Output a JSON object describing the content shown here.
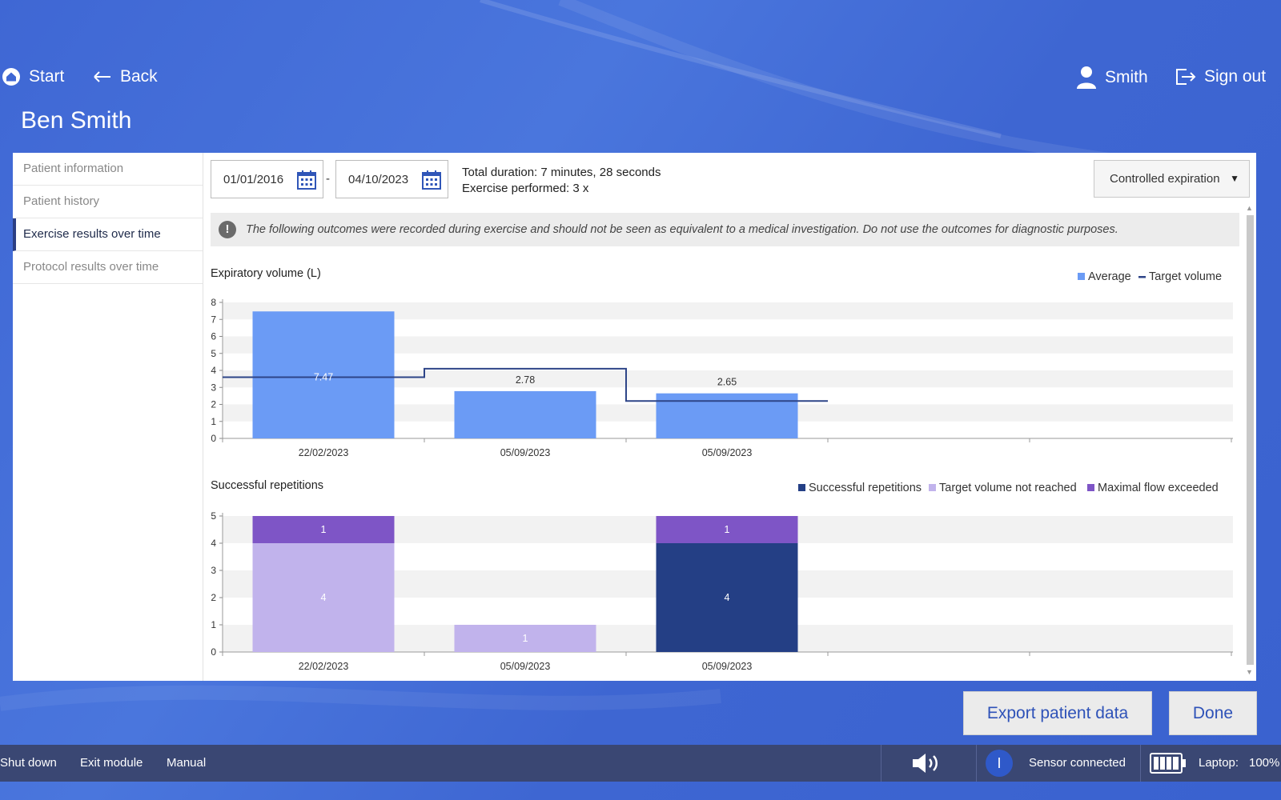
{
  "nav": {
    "start": "Start",
    "back": "Back",
    "user": "Smith",
    "signout": "Sign out"
  },
  "patient_name": "Ben Smith",
  "sidebar": {
    "items": [
      {
        "label": "Patient information"
      },
      {
        "label": "Patient history"
      },
      {
        "label": "Exercise results over time"
      },
      {
        "label": "Protocol results over time"
      }
    ]
  },
  "filters": {
    "date_from": "01/01/2016",
    "separator": "-",
    "date_to": "04/10/2023",
    "exercise_type": "Controlled expiration"
  },
  "summary": {
    "duration": "Total duration: 7 minutes, 28 seconds",
    "performed": "Exercise performed: 3 x"
  },
  "disclaimer": "The following outcomes were recorded during exercise and should not be seen as equivalent to a medical investigation. Do not use the outcomes for diagnostic purposes.",
  "buttons": {
    "export": "Export patient data",
    "done": "Done"
  },
  "statusbar": {
    "shutdown": "Shut down",
    "exit": "Exit module",
    "manual": "Manual",
    "sensor": "Sensor connected",
    "sensor_glyph": "I",
    "battery_label": "Laptop:",
    "battery_value": "100%"
  },
  "icons": {
    "start": "home-icon",
    "back": "arrow-left-icon",
    "user": "user-icon",
    "signout": "sign-out-icon",
    "calendar": "calendar-icon",
    "info": "exclamation-icon",
    "volume": "speaker-icon",
    "battery": "battery-icon"
  },
  "colors": {
    "average": "#6b9bf5",
    "target": "#2e4588",
    "successful": "#243f85",
    "not_reached": "#c1b3ec",
    "flow_exceeded": "#7e55c6"
  },
  "chart_data": [
    {
      "type": "bar",
      "title": "Expiratory volume (L)",
      "categories": [
        "22/02/2023",
        "05/09/2023",
        "05/09/2023"
      ],
      "ylim": [
        0,
        8
      ],
      "yticks": [
        0,
        1,
        2,
        3,
        4,
        5,
        6,
        7,
        8
      ],
      "series": [
        {
          "name": "Average",
          "kind": "bar",
          "values": [
            7.47,
            2.78,
            2.65
          ],
          "labels": [
            "7.47",
            "2.78",
            "2.65"
          ]
        },
        {
          "name": "Target volume",
          "kind": "step-line",
          "values": [
            3.6,
            4.1,
            2.2
          ]
        }
      ],
      "legend": "top-right",
      "grid": "horizontal bands"
    },
    {
      "type": "bar",
      "stacked": true,
      "title": "Successful repetitions",
      "categories": [
        "22/02/2023",
        "05/09/2023",
        "05/09/2023"
      ],
      "ylim": [
        0,
        5
      ],
      "yticks": [
        0,
        1,
        2,
        3,
        4,
        5
      ],
      "series": [
        {
          "name": "Successful repetitions",
          "values": [
            0,
            0,
            4
          ]
        },
        {
          "name": "Target volume not reached",
          "values": [
            4,
            1,
            0
          ]
        },
        {
          "name": "Maximal flow exceeded",
          "values": [
            1,
            0,
            1
          ]
        }
      ],
      "legend": "top-right",
      "grid": "horizontal bands"
    }
  ]
}
